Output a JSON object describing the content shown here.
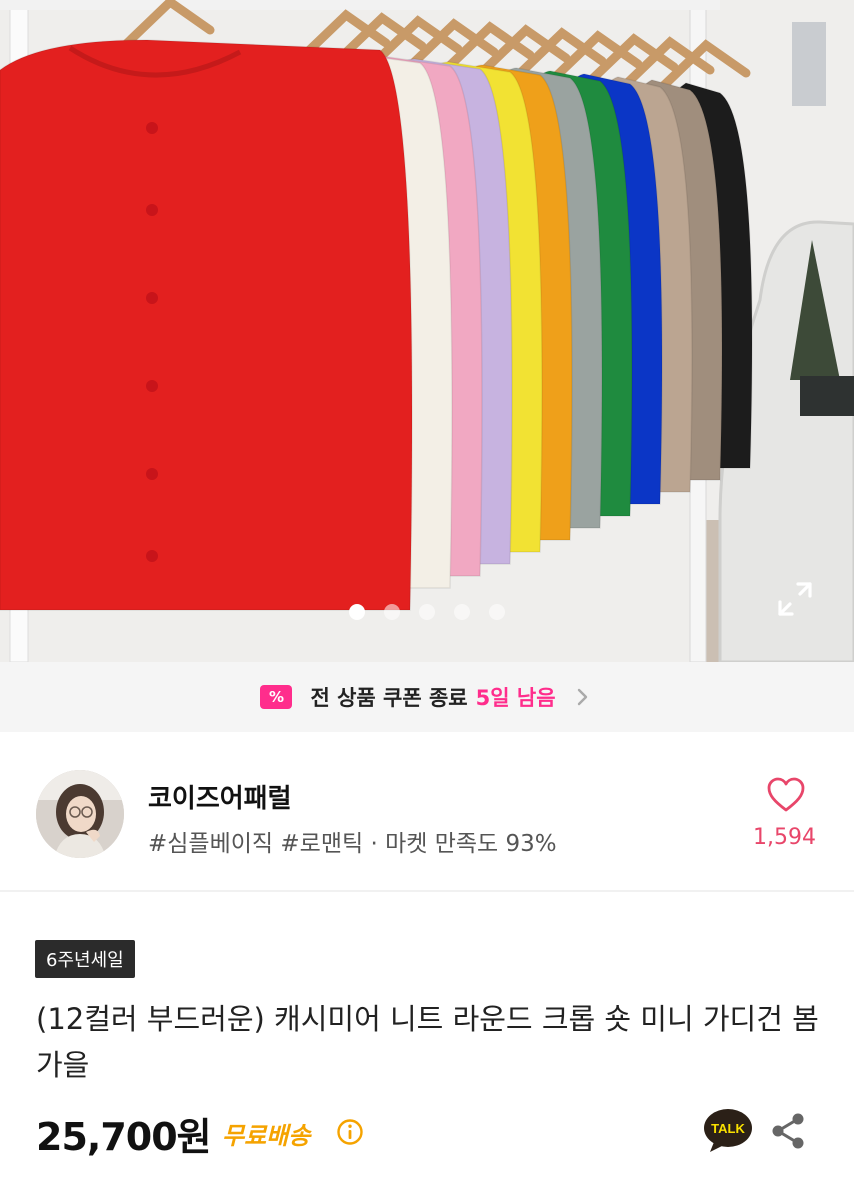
{
  "gallery": {
    "slide_count": 5,
    "active_slide": 1,
    "garment_colors": [
      "#e3201f",
      "#f3efe6",
      "#f1a8c2",
      "#c7b3e0",
      "#f2e233",
      "#efa01a",
      "#9aa3a0",
      "#1f8b3f",
      "#0b36c6",
      "#bba591",
      "#a08e7d",
      "#1c1c1c"
    ],
    "icons": {
      "expand": "expand-icon"
    }
  },
  "coupon": {
    "icon_symbol": "%",
    "text": "전 상품 쿠폰 종료",
    "remaining": "5일 남음",
    "icon": "chevron-right-icon"
  },
  "seller": {
    "name": "코이즈어패럴",
    "tags": "#심플베이직 #로맨틱 · 마켓 만족도 93%",
    "likes": "1,594",
    "icons": {
      "like": "heart-icon"
    }
  },
  "product": {
    "badge": "6주년세일",
    "title": "(12컬러 부드러운) 캐시미어 니트 라운드 크롭 숏 미니 가디건 봄 가을",
    "price": "25,700원",
    "shipping": "무료배송",
    "talk_label": "TALK",
    "icons": {
      "info": "info-icon",
      "talk": "talk-icon",
      "share": "share-icon"
    }
  },
  "colors": {
    "accent": "#ff2d8c",
    "like": "#e8466a",
    "shipping": "#f5a300",
    "talk_bg": "#2b2017"
  }
}
